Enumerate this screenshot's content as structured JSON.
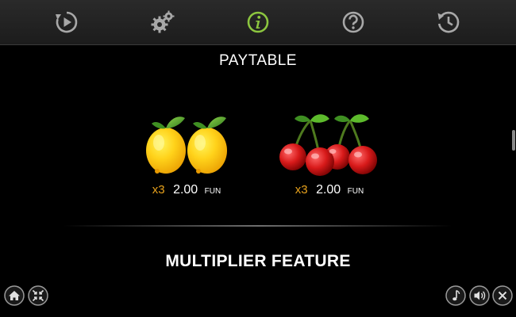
{
  "nav": {
    "items": [
      {
        "icon": "replay-icon"
      },
      {
        "icon": "settings-icon"
      },
      {
        "icon": "info-icon",
        "active": true
      },
      {
        "icon": "help-icon"
      },
      {
        "icon": "history-icon"
      }
    ],
    "colors": {
      "default": "#a8a8a8",
      "active": "#8cc63f"
    }
  },
  "paytable": {
    "title": "PAYTABLE",
    "symbols": [
      {
        "name": "lemon",
        "multiplier": "x3",
        "amount": "2.00",
        "currency": "FUN"
      },
      {
        "name": "cherry",
        "multiplier": "x3",
        "amount": "2.00",
        "currency": "FUN"
      }
    ],
    "colors": {
      "multiplier": "#e8a21c"
    }
  },
  "section": {
    "title": "MULTIPLIER FEATURE"
  },
  "footer": {
    "left": [
      {
        "icon": "home-icon"
      },
      {
        "icon": "collapse-icon"
      }
    ],
    "right": [
      {
        "icon": "music-icon"
      },
      {
        "icon": "sound-icon"
      },
      {
        "icon": "close-icon"
      }
    ]
  }
}
